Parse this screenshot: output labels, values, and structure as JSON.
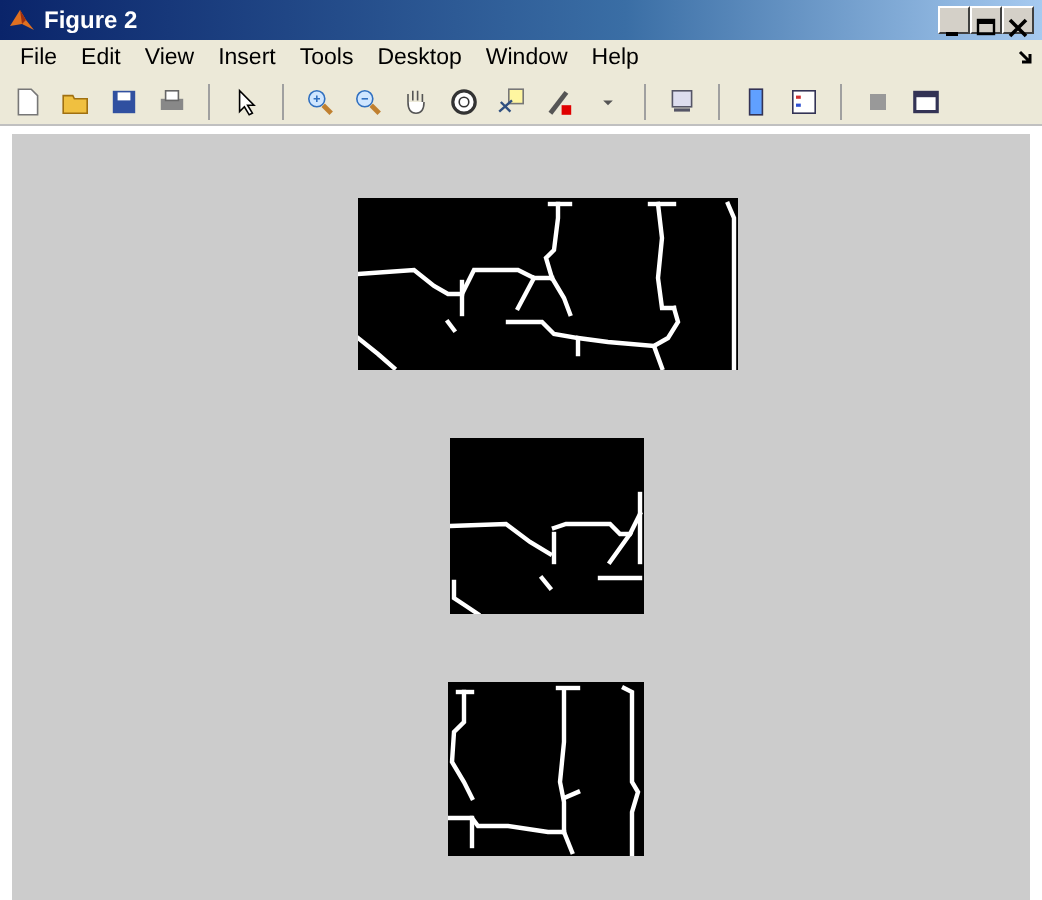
{
  "window": {
    "title": "Figure 2"
  },
  "menu": [
    "File",
    "Edit",
    "View",
    "Insert",
    "Tools",
    "Desktop",
    "Window",
    "Help"
  ]
}
